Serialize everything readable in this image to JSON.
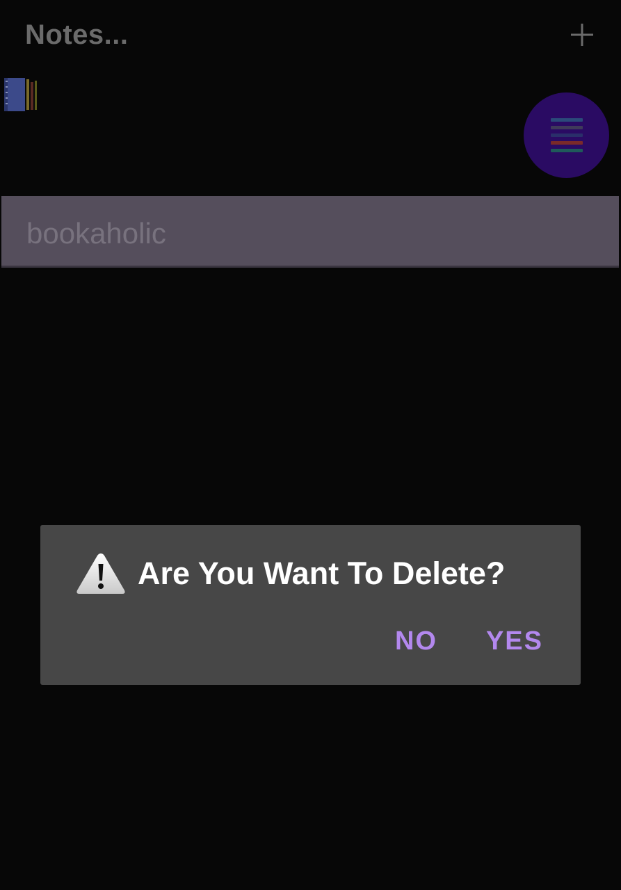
{
  "app": {
    "title": "Notes..."
  },
  "icons": {
    "add": "plus-icon",
    "notebook": "notebook-icon",
    "menu": "colored-list-icon",
    "warning": "warning-icon"
  },
  "notes": [
    {
      "title": "bookaholic"
    }
  ],
  "dialog": {
    "message": "Are You Want To Delete?",
    "no_label": "NO",
    "yes_label": "YES"
  },
  "colors": {
    "background": "#070707",
    "fab": "#2a0b63",
    "note_card": "#554e5c",
    "dialog": "#474747",
    "dialog_button": "#b388ee"
  }
}
